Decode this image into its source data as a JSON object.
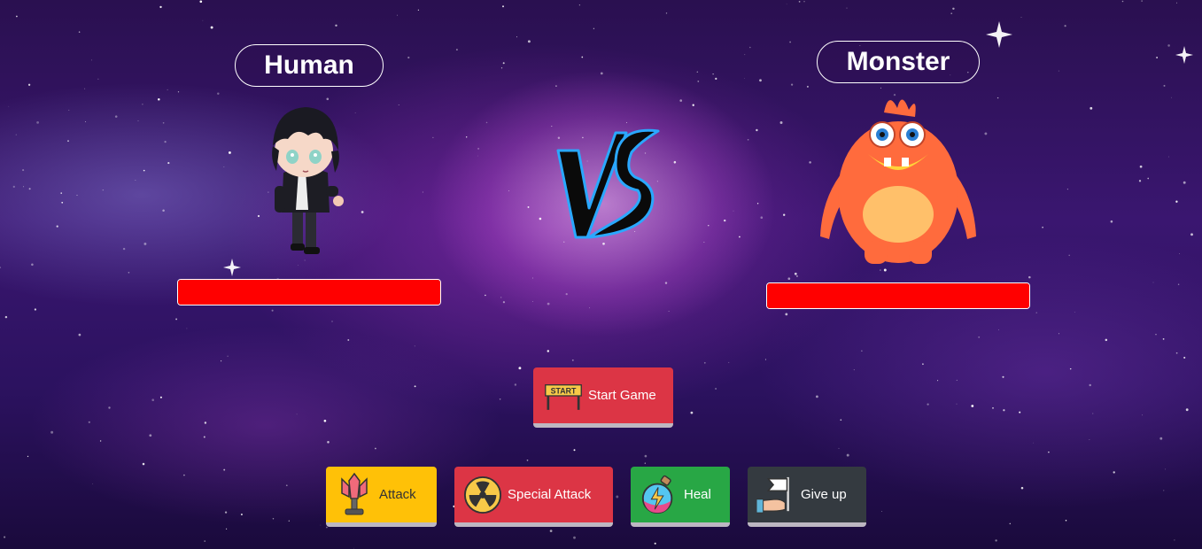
{
  "players": {
    "human": {
      "name": "Human",
      "health_fraction": 1.0
    },
    "monster": {
      "name": "Monster",
      "health_fraction": 1.0
    }
  },
  "vs_icon": "vs-emblem-icon",
  "controls": {
    "start": {
      "label": "Start Game",
      "icon": "start-sign-icon"
    },
    "attack": {
      "label": "Attack",
      "icon": "sword-icon"
    },
    "special_attack": {
      "label": "Special Attack",
      "icon": "radiation-icon"
    },
    "heal": {
      "label": "Heal",
      "icon": "potion-icon"
    },
    "give_up": {
      "label": "Give up",
      "icon": "white-flag-icon"
    }
  },
  "colors": {
    "health_bar": "#ff0000",
    "attack": "#ffc107",
    "special_attack": "#dc3545",
    "heal": "#28a745",
    "give_up": "#343a40",
    "start": "#dc3545"
  }
}
